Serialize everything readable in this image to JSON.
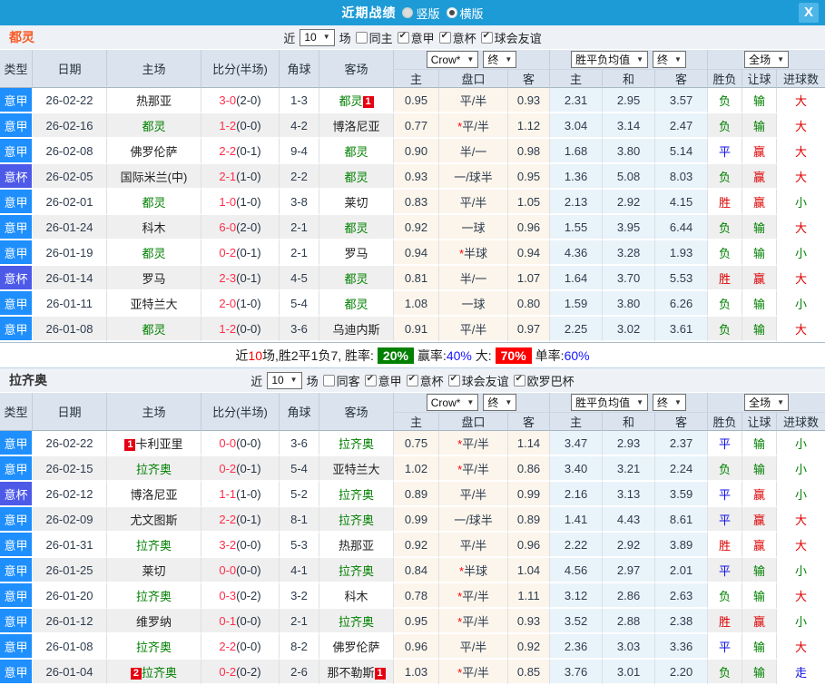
{
  "titlebar": {
    "title": "近期战绩",
    "radios": [
      {
        "label": "竖版",
        "selected": false
      },
      {
        "label": "横版",
        "selected": true
      }
    ],
    "close": "X"
  },
  "colors": {
    "titlebar": "#1d9bd7",
    "seriea": "#1e8ffd",
    "coppa": "#4d5ae8",
    "win": "#dd0000",
    "draw": "#0f0fe6",
    "lose": "#018001",
    "focus": "#018001",
    "scoreft": "#ff2e4a",
    "badge": "#e60012",
    "rategreen": "#018001",
    "ratered": "#ff0000",
    "team-a": "#f95b25"
  },
  "columns": {
    "type": "类型",
    "date": "日期",
    "home": "主场",
    "score": "比分(半场)",
    "corner": "角球",
    "away": "客场",
    "odds_provider": "Crow*",
    "odds_stage": "终",
    "avg_label": "胜平负均值",
    "avg_stage": "终",
    "scope": "全场",
    "sub": [
      "主",
      "盘口",
      "客",
      "主",
      "和",
      "客",
      "胜负",
      "让球",
      "进球数"
    ]
  },
  "sections": [
    {
      "team": "都灵",
      "filter": {
        "prefix": "近",
        "count": "10",
        "suffix": "场",
        "same_label": "同主",
        "same_checked": false,
        "options": [
          {
            "label": "意甲",
            "checked": true
          },
          {
            "label": "意杯",
            "checked": true
          },
          {
            "label": "球会友谊",
            "checked": true
          }
        ]
      },
      "rows": [
        {
          "lg": "意甲",
          "lg_c": "jia",
          "date": "26-02-22",
          "hb": "",
          "home": "热那亚",
          "home_c": "",
          "ft": "3-0",
          "ht": "(2-0)",
          "corner": "1-3",
          "away": "都灵",
          "away_c": "self",
          "ab": "1",
          "o1": "0.95",
          "hs": "",
          "hc": "平/半",
          "o2": "0.93",
          "m1": "2.31",
          "m2": "2.95",
          "m3": "3.57",
          "res": "负",
          "res_c": "g",
          "let": "输",
          "let_c": "g",
          "goal": "大",
          "goal_c": "r"
        },
        {
          "lg": "意甲",
          "lg_c": "jia",
          "date": "26-02-16",
          "hb": "",
          "home": "都灵",
          "home_c": "self",
          "ft": "1-2",
          "ht": "(0-0)",
          "corner": "4-2",
          "away": "博洛尼亚",
          "away_c": "",
          "ab": "",
          "o1": "0.77",
          "hs": "*",
          "hc": "平/半",
          "o2": "1.12",
          "m1": "3.04",
          "m2": "3.14",
          "m3": "2.47",
          "res": "负",
          "res_c": "g",
          "let": "输",
          "let_c": "g",
          "goal": "大",
          "goal_c": "r"
        },
        {
          "lg": "意甲",
          "lg_c": "jia",
          "date": "26-02-08",
          "hb": "",
          "home": "佛罗伦萨",
          "home_c": "",
          "ft": "2-2",
          "ht": "(0-1)",
          "corner": "9-4",
          "away": "都灵",
          "away_c": "self",
          "ab": "",
          "o1": "0.90",
          "hs": "",
          "hc": "半/一",
          "o2": "0.98",
          "m1": "1.68",
          "m2": "3.80",
          "m3": "5.14",
          "res": "平",
          "res_c": "b",
          "let": "赢",
          "let_c": "r",
          "goal": "大",
          "goal_c": "r"
        },
        {
          "lg": "意杯",
          "lg_c": "bei",
          "date": "26-02-05",
          "hb": "",
          "home": "国际米兰(中)",
          "home_c": "",
          "ft": "2-1",
          "ht": "(1-0)",
          "corner": "2-2",
          "away": "都灵",
          "away_c": "self",
          "ab": "",
          "o1": "0.93",
          "hs": "",
          "hc": "一/球半",
          "o2": "0.95",
          "m1": "1.36",
          "m2": "5.08",
          "m3": "8.03",
          "res": "负",
          "res_c": "g",
          "let": "赢",
          "let_c": "r",
          "goal": "大",
          "goal_c": "r"
        },
        {
          "lg": "意甲",
          "lg_c": "jia",
          "date": "26-02-01",
          "hb": "",
          "home": "都灵",
          "home_c": "self",
          "ft": "1-0",
          "ht": "(1-0)",
          "corner": "3-8",
          "away": "莱切",
          "away_c": "",
          "ab": "",
          "o1": "0.83",
          "hs": "",
          "hc": "平/半",
          "o2": "1.05",
          "m1": "2.13",
          "m2": "2.92",
          "m3": "4.15",
          "res": "胜",
          "res_c": "r",
          "let": "赢",
          "let_c": "r",
          "goal": "小",
          "goal_c": "g"
        },
        {
          "lg": "意甲",
          "lg_c": "jia",
          "date": "26-01-24",
          "hb": "",
          "home": "科木",
          "home_c": "",
          "ft": "6-0",
          "ht": "(2-0)",
          "corner": "2-1",
          "away": "都灵",
          "away_c": "self",
          "ab": "",
          "o1": "0.92",
          "hs": "",
          "hc": "一球",
          "o2": "0.96",
          "m1": "1.55",
          "m2": "3.95",
          "m3": "6.44",
          "res": "负",
          "res_c": "g",
          "let": "输",
          "let_c": "g",
          "goal": "大",
          "goal_c": "r"
        },
        {
          "lg": "意甲",
          "lg_c": "jia",
          "date": "26-01-19",
          "hb": "",
          "home": "都灵",
          "home_c": "self",
          "ft": "0-2",
          "ht": "(0-1)",
          "corner": "2-1",
          "away": "罗马",
          "away_c": "",
          "ab": "",
          "o1": "0.94",
          "hs": "*",
          "hc": "半球",
          "o2": "0.94",
          "m1": "4.36",
          "m2": "3.28",
          "m3": "1.93",
          "res": "负",
          "res_c": "g",
          "let": "输",
          "let_c": "g",
          "goal": "小",
          "goal_c": "g"
        },
        {
          "lg": "意杯",
          "lg_c": "bei",
          "date": "26-01-14",
          "hb": "",
          "home": "罗马",
          "home_c": "",
          "ft": "2-3",
          "ht": "(0-1)",
          "corner": "4-5",
          "away": "都灵",
          "away_c": "self",
          "ab": "",
          "o1": "0.81",
          "hs": "",
          "hc": "半/一",
          "o2": "1.07",
          "m1": "1.64",
          "m2": "3.70",
          "m3": "5.53",
          "res": "胜",
          "res_c": "r",
          "let": "赢",
          "let_c": "r",
          "goal": "大",
          "goal_c": "r"
        },
        {
          "lg": "意甲",
          "lg_c": "jia",
          "date": "26-01-11",
          "hb": "",
          "home": "亚特兰大",
          "home_c": "",
          "ft": "2-0",
          "ht": "(1-0)",
          "corner": "5-4",
          "away": "都灵",
          "away_c": "self",
          "ab": "",
          "o1": "1.08",
          "hs": "",
          "hc": "一球",
          "o2": "0.80",
          "m1": "1.59",
          "m2": "3.80",
          "m3": "6.26",
          "res": "负",
          "res_c": "g",
          "let": "输",
          "let_c": "g",
          "goal": "小",
          "goal_c": "g"
        },
        {
          "lg": "意甲",
          "lg_c": "jia",
          "date": "26-01-08",
          "hb": "",
          "home": "都灵",
          "home_c": "self",
          "ft": "1-2",
          "ht": "(0-0)",
          "corner": "3-6",
          "away": "乌迪内斯",
          "away_c": "",
          "ab": "",
          "o1": "0.91",
          "hs": "",
          "hc": "平/半",
          "o2": "0.97",
          "m1": "2.25",
          "m2": "3.02",
          "m3": "3.61",
          "res": "负",
          "res_c": "g",
          "let": "输",
          "let_c": "g",
          "goal": "大",
          "goal_c": "r"
        }
      ],
      "summary": {
        "seg1": "近",
        "count": "10",
        "seg2": "场,胜2平1负7, 胜率:",
        "win_rate": "20%",
        "seg3": "赢率:",
        "win_pct": "40%",
        "seg4": " 大:",
        "big_rate": "70%",
        "seg5": "单率:",
        "single_pct": "60%"
      }
    },
    {
      "team": "拉齐奥",
      "filter": {
        "prefix": "近",
        "count": "10",
        "suffix": "场",
        "same_label": "同客",
        "same_checked": false,
        "options": [
          {
            "label": "意甲",
            "checked": true
          },
          {
            "label": "意杯",
            "checked": true
          },
          {
            "label": "球会友谊",
            "checked": true
          },
          {
            "label": "欧罗巴杯",
            "checked": true
          }
        ]
      },
      "rows": [
        {
          "lg": "意甲",
          "lg_c": "jia",
          "date": "26-02-22",
          "hb": "1",
          "home": "卡利亚里",
          "home_c": "",
          "ft": "0-0",
          "ht": "(0-0)",
          "corner": "3-6",
          "away": "拉齐奥",
          "away_c": "self",
          "ab": "",
          "o1": "0.75",
          "hs": "*",
          "hc": "平/半",
          "o2": "1.14",
          "m1": "3.47",
          "m2": "2.93",
          "m3": "2.37",
          "res": "平",
          "res_c": "b",
          "let": "输",
          "let_c": "g",
          "goal": "小",
          "goal_c": "g"
        },
        {
          "lg": "意甲",
          "lg_c": "jia",
          "date": "26-02-15",
          "hb": "",
          "home": "拉齐奥",
          "home_c": "self",
          "ft": "0-2",
          "ht": "(0-1)",
          "corner": "5-4",
          "away": "亚特兰大",
          "away_c": "",
          "ab": "",
          "o1": "1.02",
          "hs": "*",
          "hc": "平/半",
          "o2": "0.86",
          "m1": "3.40",
          "m2": "3.21",
          "m3": "2.24",
          "res": "负",
          "res_c": "g",
          "let": "输",
          "let_c": "g",
          "goal": "小",
          "goal_c": "g"
        },
        {
          "lg": "意杯",
          "lg_c": "bei",
          "date": "26-02-12",
          "hb": "",
          "home": "博洛尼亚",
          "home_c": "",
          "ft": "1-1",
          "ht": "(1-0)",
          "corner": "5-2",
          "away": "拉齐奥",
          "away_c": "self",
          "ab": "",
          "o1": "0.89",
          "hs": "",
          "hc": "平/半",
          "o2": "0.99",
          "m1": "2.16",
          "m2": "3.13",
          "m3": "3.59",
          "res": "平",
          "res_c": "b",
          "let": "赢",
          "let_c": "r",
          "goal": "小",
          "goal_c": "g"
        },
        {
          "lg": "意甲",
          "lg_c": "jia",
          "date": "26-02-09",
          "hb": "",
          "home": "尤文图斯",
          "home_c": "",
          "ft": "2-2",
          "ht": "(0-1)",
          "corner": "8-1",
          "away": "拉齐奥",
          "away_c": "self",
          "ab": "",
          "o1": "0.99",
          "hs": "",
          "hc": "一/球半",
          "o2": "0.89",
          "m1": "1.41",
          "m2": "4.43",
          "m3": "8.61",
          "res": "平",
          "res_c": "b",
          "let": "赢",
          "let_c": "r",
          "goal": "大",
          "goal_c": "r"
        },
        {
          "lg": "意甲",
          "lg_c": "jia",
          "date": "26-01-31",
          "hb": "",
          "home": "拉齐奥",
          "home_c": "self",
          "ft": "3-2",
          "ht": "(0-0)",
          "corner": "5-3",
          "away": "热那亚",
          "away_c": "",
          "ab": "",
          "o1": "0.92",
          "hs": "",
          "hc": "平/半",
          "o2": "0.96",
          "m1": "2.22",
          "m2": "2.92",
          "m3": "3.89",
          "res": "胜",
          "res_c": "r",
          "let": "赢",
          "let_c": "r",
          "goal": "大",
          "goal_c": "r"
        },
        {
          "lg": "意甲",
          "lg_c": "jia",
          "date": "26-01-25",
          "hb": "",
          "home": "莱切",
          "home_c": "",
          "ft": "0-0",
          "ht": "(0-0)",
          "corner": "4-1",
          "away": "拉齐奥",
          "away_c": "self",
          "ab": "",
          "o1": "0.84",
          "hs": "*",
          "hc": "半球",
          "o2": "1.04",
          "m1": "4.56",
          "m2": "2.97",
          "m3": "2.01",
          "res": "平",
          "res_c": "b",
          "let": "输",
          "let_c": "g",
          "goal": "小",
          "goal_c": "g"
        },
        {
          "lg": "意甲",
          "lg_c": "jia",
          "date": "26-01-20",
          "hb": "",
          "home": "拉齐奥",
          "home_c": "self",
          "ft": "0-3",
          "ht": "(0-2)",
          "corner": "3-2",
          "away": "科木",
          "away_c": "",
          "ab": "",
          "o1": "0.78",
          "hs": "*",
          "hc": "平/半",
          "o2": "1.11",
          "m1": "3.12",
          "m2": "2.86",
          "m3": "2.63",
          "res": "负",
          "res_c": "g",
          "let": "输",
          "let_c": "g",
          "goal": "大",
          "goal_c": "r"
        },
        {
          "lg": "意甲",
          "lg_c": "jia",
          "date": "26-01-12",
          "hb": "",
          "home": "维罗纳",
          "home_c": "",
          "ft": "0-1",
          "ht": "(0-0)",
          "corner": "2-1",
          "away": "拉齐奥",
          "away_c": "self",
          "ab": "",
          "o1": "0.95",
          "hs": "*",
          "hc": "平/半",
          "o2": "0.93",
          "m1": "3.52",
          "m2": "2.88",
          "m3": "2.38",
          "res": "胜",
          "res_c": "r",
          "let": "赢",
          "let_c": "r",
          "goal": "小",
          "goal_c": "g"
        },
        {
          "lg": "意甲",
          "lg_c": "jia",
          "date": "26-01-08",
          "hb": "",
          "home": "拉齐奥",
          "home_c": "self",
          "ft": "2-2",
          "ht": "(0-0)",
          "corner": "8-2",
          "away": "佛罗伦萨",
          "away_c": "",
          "ab": "",
          "o1": "0.96",
          "hs": "",
          "hc": "平/半",
          "o2": "0.92",
          "m1": "2.36",
          "m2": "3.03",
          "m3": "3.36",
          "res": "平",
          "res_c": "b",
          "let": "输",
          "let_c": "g",
          "goal": "大",
          "goal_c": "r"
        },
        {
          "lg": "意甲",
          "lg_c": "jia",
          "date": "26-01-04",
          "hb": "2",
          "home": "拉齐奥",
          "home_c": "self",
          "ft": "0-2",
          "ht": "(0-2)",
          "corner": "2-6",
          "away": "那不勒斯",
          "away_c": "",
          "ab": "1",
          "o1": "1.03",
          "hs": "*",
          "hc": "平/半",
          "o2": "0.85",
          "m1": "3.76",
          "m2": "3.01",
          "m3": "2.20",
          "res": "负",
          "res_c": "g",
          "let": "输",
          "let_c": "g",
          "goal": "走",
          "goal_c": "b"
        }
      ]
    }
  ]
}
